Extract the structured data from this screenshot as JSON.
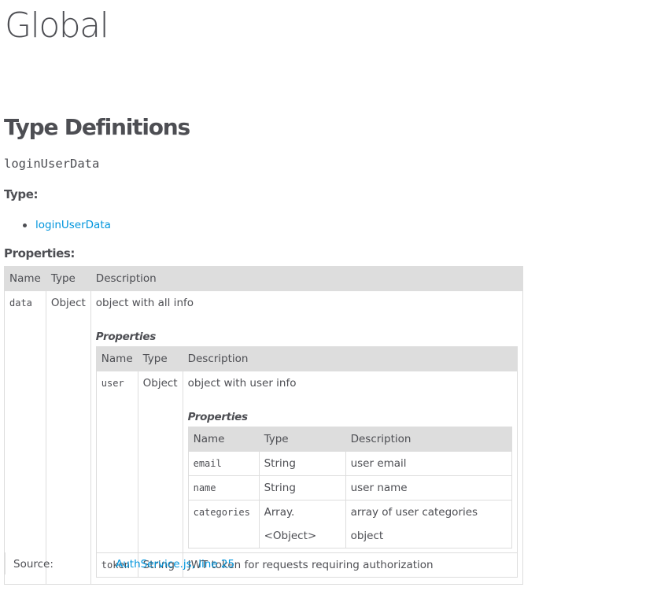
{
  "page": {
    "title": "Global",
    "section_title": "Type Definitions",
    "member_name": "loginUserData"
  },
  "type_section": {
    "heading": "Type:",
    "items": [
      "loginUserData"
    ]
  },
  "properties_section": {
    "heading": "Properties:",
    "headers": {
      "name": "Name",
      "type": "Type",
      "description": "Description"
    },
    "nested_label": "Properties",
    "data_row": {
      "name": "data",
      "type": "Object",
      "description": "object with all info",
      "user_row": {
        "name": "user",
        "type": "Object",
        "description": "object with user info",
        "rows": [
          {
            "name": "email",
            "type": "String",
            "description": "user email"
          },
          {
            "name": "name",
            "type": "String",
            "description": "user name"
          },
          {
            "name": "categories",
            "type": "Array.<Object>",
            "description": "array of user categories object"
          }
        ]
      },
      "token_row": {
        "name": "token",
        "type": "String",
        "description": "JWT token for requests requiring authorization"
      }
    }
  },
  "source": {
    "label": "Source:",
    "file": "AuthService.js",
    "separator": ", ",
    "line": "line 25"
  },
  "colors": {
    "text": "#4d4e53",
    "link": "#0095dd",
    "table_header_bg": "#dddddd",
    "table_border": "#dddddd"
  }
}
